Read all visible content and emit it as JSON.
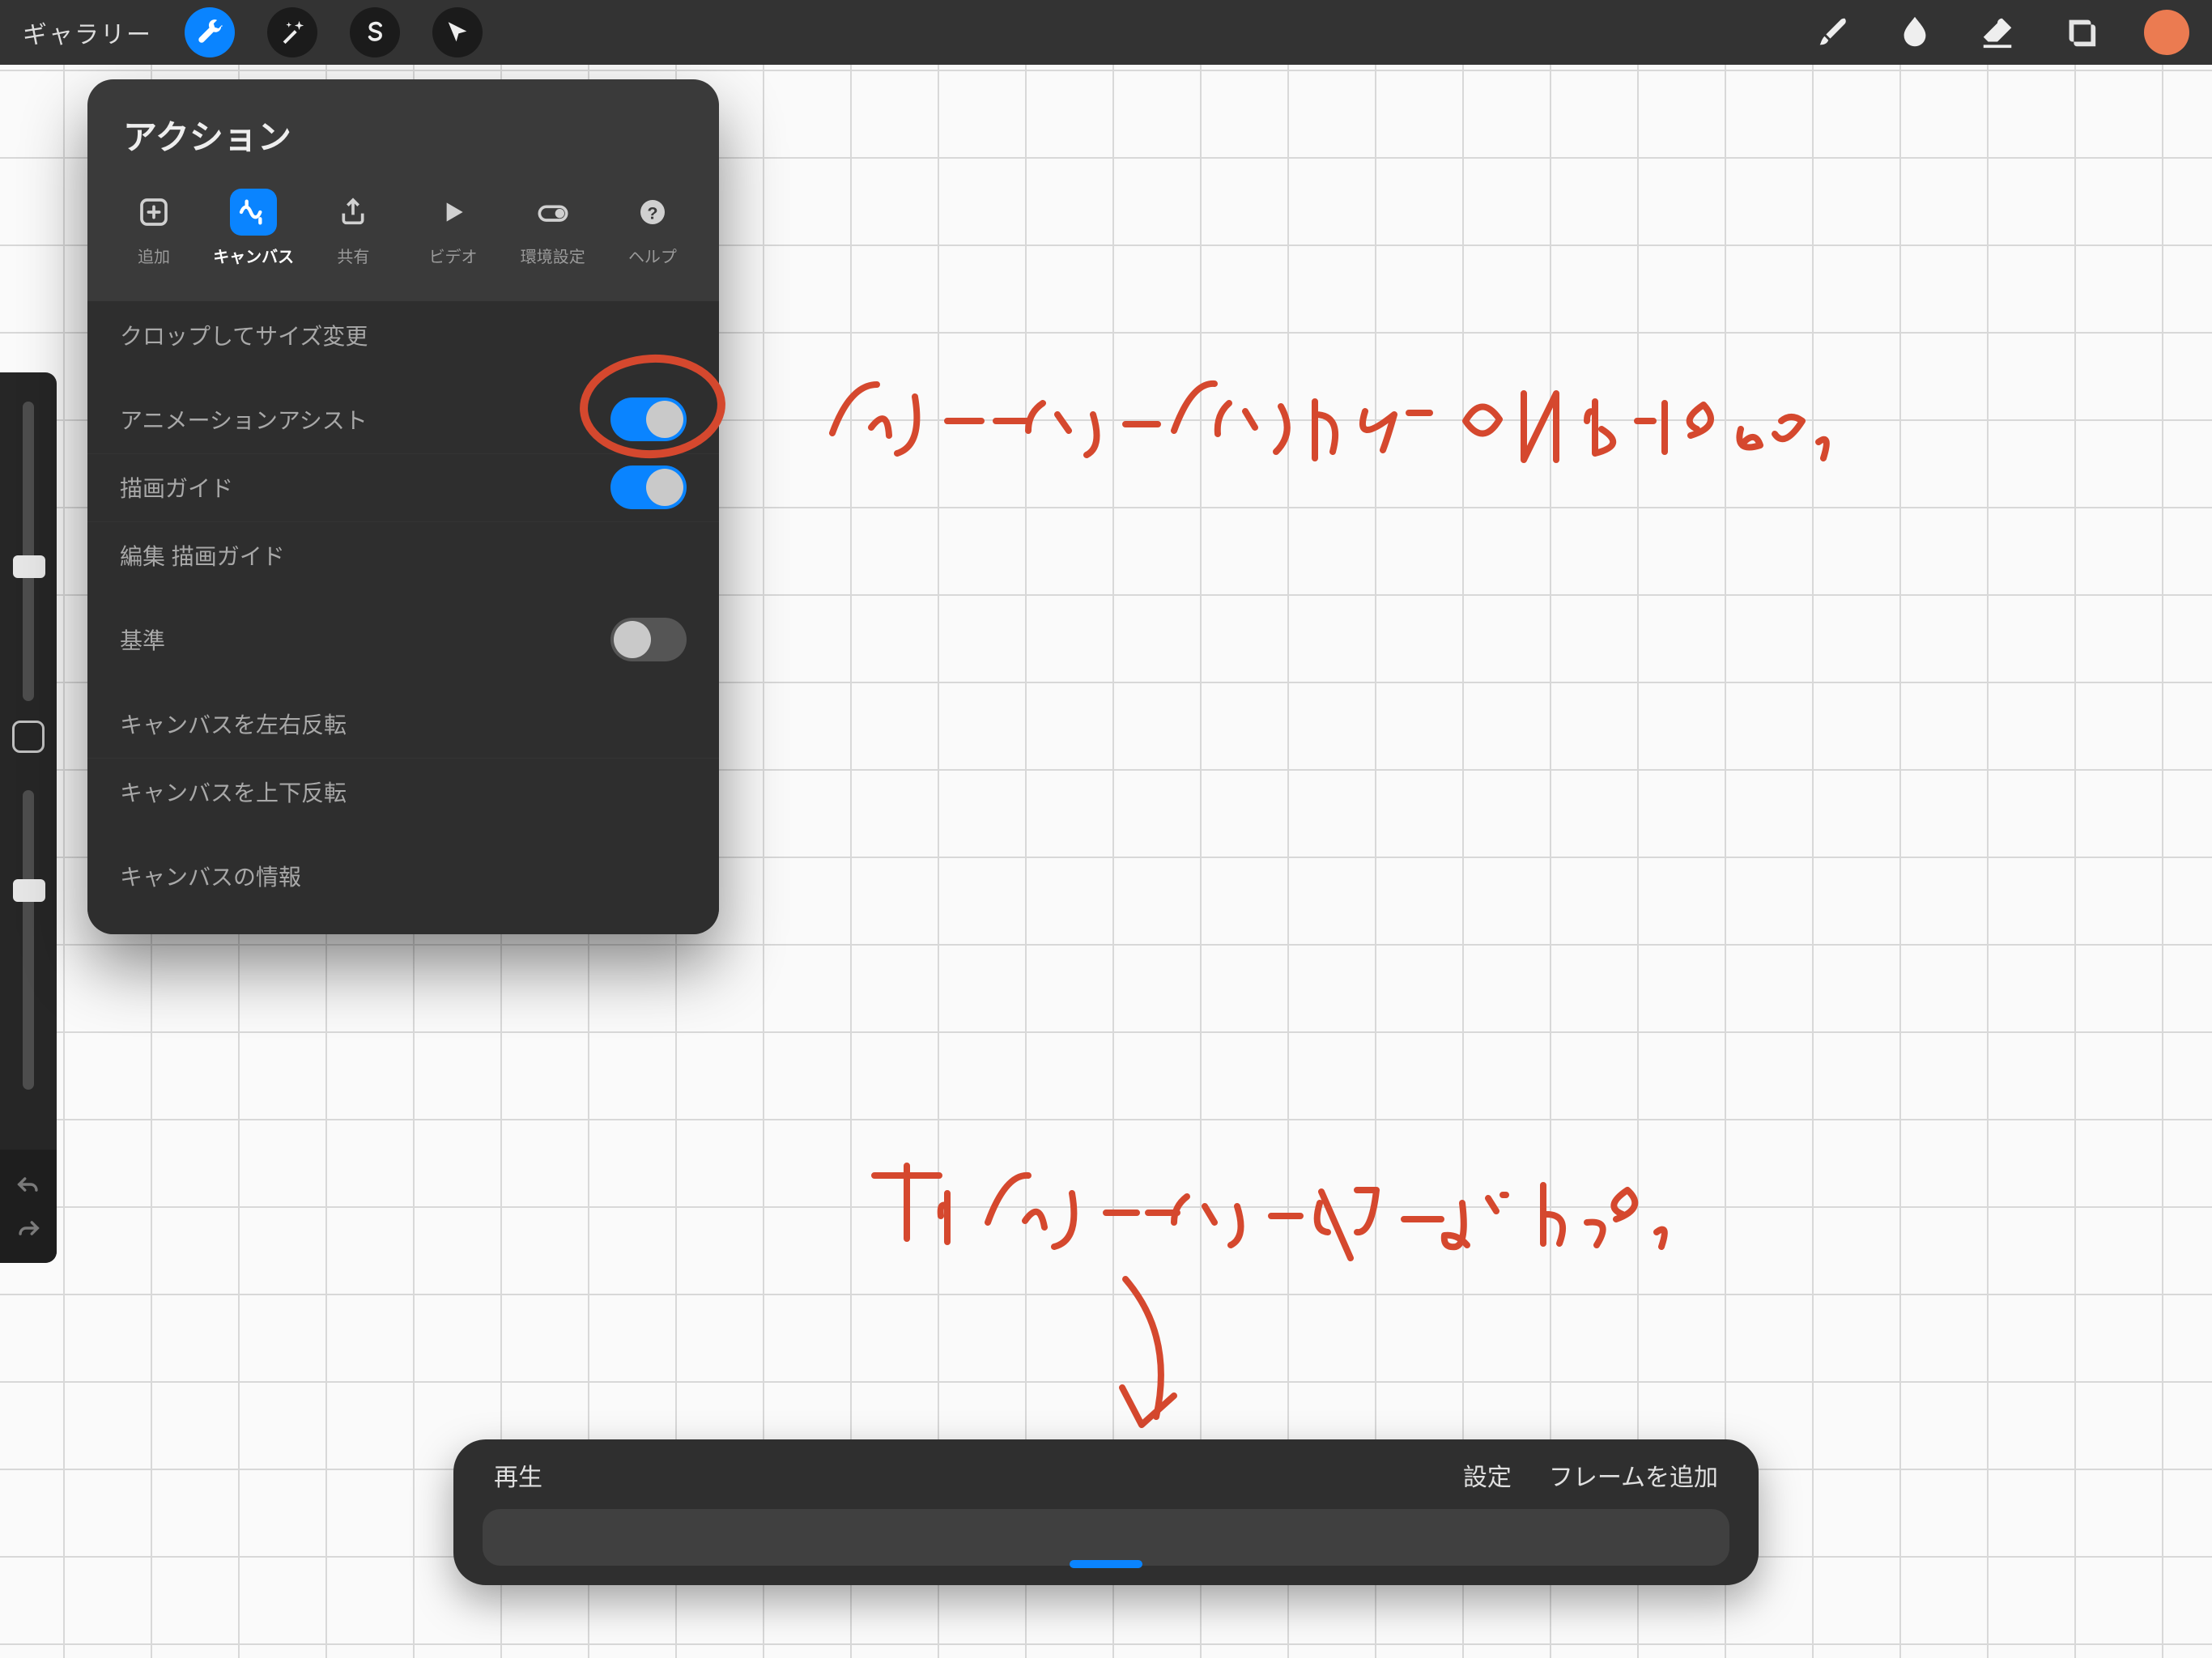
{
  "topbar": {
    "gallery_label": "ギャラリー"
  },
  "colors": {
    "accent": "#0a84ff",
    "swatch": "#eb7b51",
    "annotation": "#d5482e"
  },
  "actions_panel": {
    "title": "アクション",
    "tabs": [
      {
        "label": "追加",
        "icon": "add"
      },
      {
        "label": "キャンバス",
        "icon": "canvas",
        "active": true
      },
      {
        "label": "共有",
        "icon": "share"
      },
      {
        "label": "ビデオ",
        "icon": "video"
      },
      {
        "label": "環境設定",
        "icon": "prefs"
      },
      {
        "label": "ヘルプ",
        "icon": "help"
      }
    ],
    "groups": [
      {
        "rows": [
          {
            "label": "クロップしてサイズ変更",
            "type": "link"
          }
        ]
      },
      {
        "rows": [
          {
            "label": "アニメーションアシスト",
            "type": "toggle",
            "on": true,
            "highlighted": true
          },
          {
            "label": "描画ガイド",
            "type": "toggle",
            "on": true
          },
          {
            "label": "編集 描画ガイド",
            "type": "link"
          }
        ]
      },
      {
        "rows": [
          {
            "label": "基準",
            "type": "toggle",
            "on": false
          }
        ]
      },
      {
        "rows": [
          {
            "label": "キャンバスを左右反転",
            "type": "link"
          },
          {
            "label": "キャンバスを上下反転",
            "type": "link"
          }
        ]
      },
      {
        "rows": [
          {
            "label": "キャンバスの情報",
            "type": "link"
          }
        ]
      }
    ]
  },
  "annotations": {
    "line1": "アニメーションアシストをONにする。",
    "line2": "下にアニメーションバーが出る。"
  },
  "animbar": {
    "play_label": "再生",
    "settings_label": "設定",
    "add_frame_label": "フレームを追加"
  }
}
